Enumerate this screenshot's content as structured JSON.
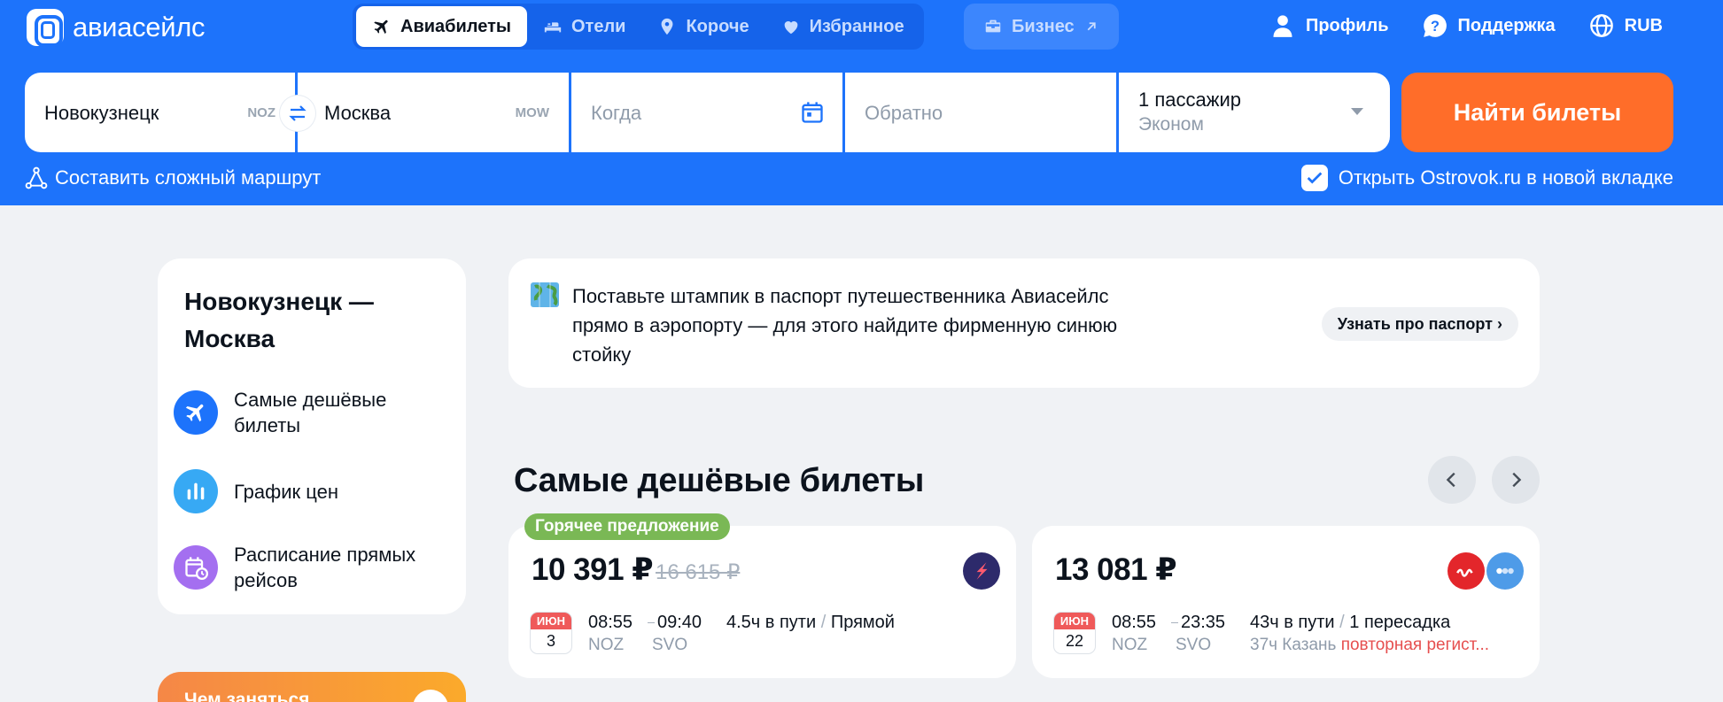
{
  "header": {
    "logo_text": "авиасейлс",
    "tabs": [
      {
        "label": "Авиабилеты",
        "icon": "plane-icon",
        "active": true
      },
      {
        "label": "Отели",
        "icon": "bed-icon"
      },
      {
        "label": "Короче",
        "icon": "location-pin-icon"
      },
      {
        "label": "Избранное",
        "icon": "heart-icon"
      }
    ],
    "business_label": "Бизнес",
    "profile_label": "Профиль",
    "support_label": "Поддержка",
    "currency_label": "RUB"
  },
  "search": {
    "from_value": "Новокузнецк",
    "from_code": "NOZ",
    "to_value": "Москва",
    "to_code": "MOW",
    "when_placeholder": "Когда",
    "return_placeholder": "Обратно",
    "passengers": "1 пассажир",
    "cabin_class": "Эконом",
    "submit_label": "Найти билеты",
    "complex_route_label": "Составить сложный маршрут",
    "ostrovok_label": "Открыть Ostrovok.ru в новой вкладке",
    "ostrovok_checked": true
  },
  "sidebar": {
    "title": "Новокузнецк — Москва",
    "items": [
      {
        "label": "Самые дешёвые билеты",
        "icon": "plane-icon",
        "color": "#1d73fb"
      },
      {
        "label": "График цен",
        "icon": "bar-chart-icon",
        "color": "#37a9f4"
      },
      {
        "label": "Расписание прямых рейсов",
        "icon": "calendar-clock-icon",
        "color": "#a46ff0"
      }
    ],
    "promo_label": "Чем заняться"
  },
  "banner": {
    "text": "Поставьте штампик в паспорт путешественника Авиасейлс прямо в аэропорту — для этого найдите фирменную синюю стойку",
    "button_label": "Узнать про паспорт ›"
  },
  "cheapest": {
    "title": "Самые дешёвые билеты",
    "hot_label": "Горячее предложение",
    "tickets": [
      {
        "price": "10 391 ₽",
        "old_price": "16 615 ₽",
        "month": "ИЮН",
        "day": "3",
        "depart_time": "08:55",
        "arrive_time": "09:40",
        "from_code": "NOZ",
        "to_code": "SVO",
        "duration": "4.5ч в пути",
        "stops": "Прямой"
      },
      {
        "price": "13 081 ₽",
        "month": "ИЮН",
        "day": "22",
        "depart_time": "08:55",
        "arrive_time": "23:35",
        "from_code": "NOZ",
        "to_code": "SVO",
        "duration": "43ч в пути",
        "stops": "1 пересадка",
        "transfer": "37ч Казань",
        "transfer_warning": "повторная регист..."
      }
    ]
  },
  "colors": {
    "brand_blue": "#1d73fb",
    "accent_orange": "#ff6d29",
    "hot_green": "#7ab855",
    "warning_red": "#e64f4f"
  }
}
